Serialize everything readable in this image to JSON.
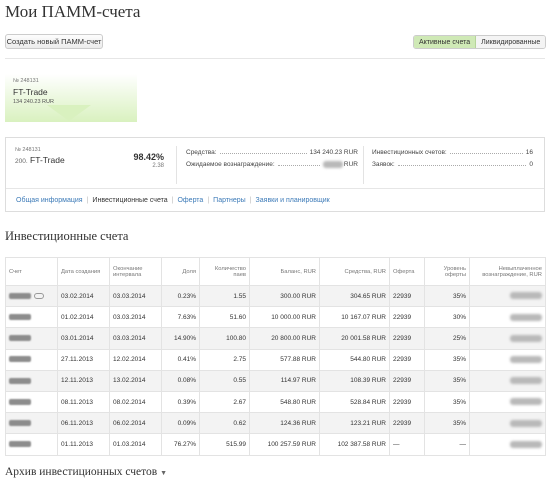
{
  "page_title": "Мои ПАММ-счета",
  "create_button": "Создать новый ПАММ-счет",
  "toggle": {
    "active": "Активные счета",
    "liquidated": "Ликвидированные"
  },
  "card": {
    "number": "№ 248131",
    "name": "FT-Trade",
    "amount": "134 240.23 RUR"
  },
  "panel": {
    "number": "№ 248131",
    "rank": "200.",
    "name": "FT-Trade",
    "percent": "98.42%",
    "sub": "2.38",
    "funds_label": "Средства:",
    "funds_value": "134 240.23 RUR",
    "reward_label": "Ожидаемое вознаграждение:",
    "reward_value": "RUR",
    "invest_label": "Инвестиционных счетов:",
    "invest_value": "16",
    "requests_label": "Заявок:",
    "requests_value": "0"
  },
  "nav": {
    "general": "Общая информация",
    "investment": "Инвестиционные счета",
    "offer": "Оферта",
    "partners": "Партнеры",
    "requests": "Заявки и планировщик"
  },
  "section_title": "Инвестиционные счета",
  "table": {
    "headers": [
      "Счет",
      "Дата создания",
      "Окончание интервала",
      "Доля",
      "Количество паев",
      "Баланс, RUR",
      "Средства, RUR",
      "Оферта",
      "Уровень оферты",
      "Невыплаченное вознаграждение, RUR"
    ],
    "rows": [
      {
        "created": "03.02.2014",
        "end": "03.03.2014",
        "share": "0.23%",
        "units": "1.55",
        "balance": "300.00 RUR",
        "funds": "304.65 RUR",
        "offer": "22939",
        "level": "35%"
      },
      {
        "created": "01.02.2014",
        "end": "03.03.2014",
        "share": "7.63%",
        "units": "51.60",
        "balance": "10 000.00 RUR",
        "funds": "10 167.07 RUR",
        "offer": "22939",
        "level": "30%"
      },
      {
        "created": "03.01.2014",
        "end": "03.03.2014",
        "share": "14.90%",
        "units": "100.80",
        "balance": "20 800.00 RUR",
        "funds": "20 001.58 RUR",
        "offer": "22939",
        "level": "25%"
      },
      {
        "created": "27.11.2013",
        "end": "12.02.2014",
        "share": "0.41%",
        "units": "2.75",
        "balance": "577.88 RUR",
        "funds": "544.80 RUR",
        "offer": "22939",
        "level": "35%"
      },
      {
        "created": "12.11.2013",
        "end": "13.02.2014",
        "share": "0.08%",
        "units": "0.55",
        "balance": "114.97 RUR",
        "funds": "108.39 RUR",
        "offer": "22939",
        "level": "35%"
      },
      {
        "created": "08.11.2013",
        "end": "08.02.2014",
        "share": "0.39%",
        "units": "2.67",
        "balance": "548.80 RUR",
        "funds": "528.84 RUR",
        "offer": "22939",
        "level": "35%"
      },
      {
        "created": "06.11.2013",
        "end": "06.02.2014",
        "share": "0.09%",
        "units": "0.62",
        "balance": "124.36 RUR",
        "funds": "123.21 RUR",
        "offer": "22939",
        "level": "35%"
      },
      {
        "created": "01.11.2013",
        "end": "01.03.2014",
        "share": "76.27%",
        "units": "515.99",
        "balance": "100 257.59 RUR",
        "funds": "102 387.58 RUR",
        "offer": "—",
        "level": "—"
      }
    ]
  },
  "archive_title": "Архив инвестиционных счетов",
  "colors": {
    "accent_green": "#d9f1bf",
    "link": "#3d7bb8",
    "toggle_active": "#cfe9b6"
  }
}
